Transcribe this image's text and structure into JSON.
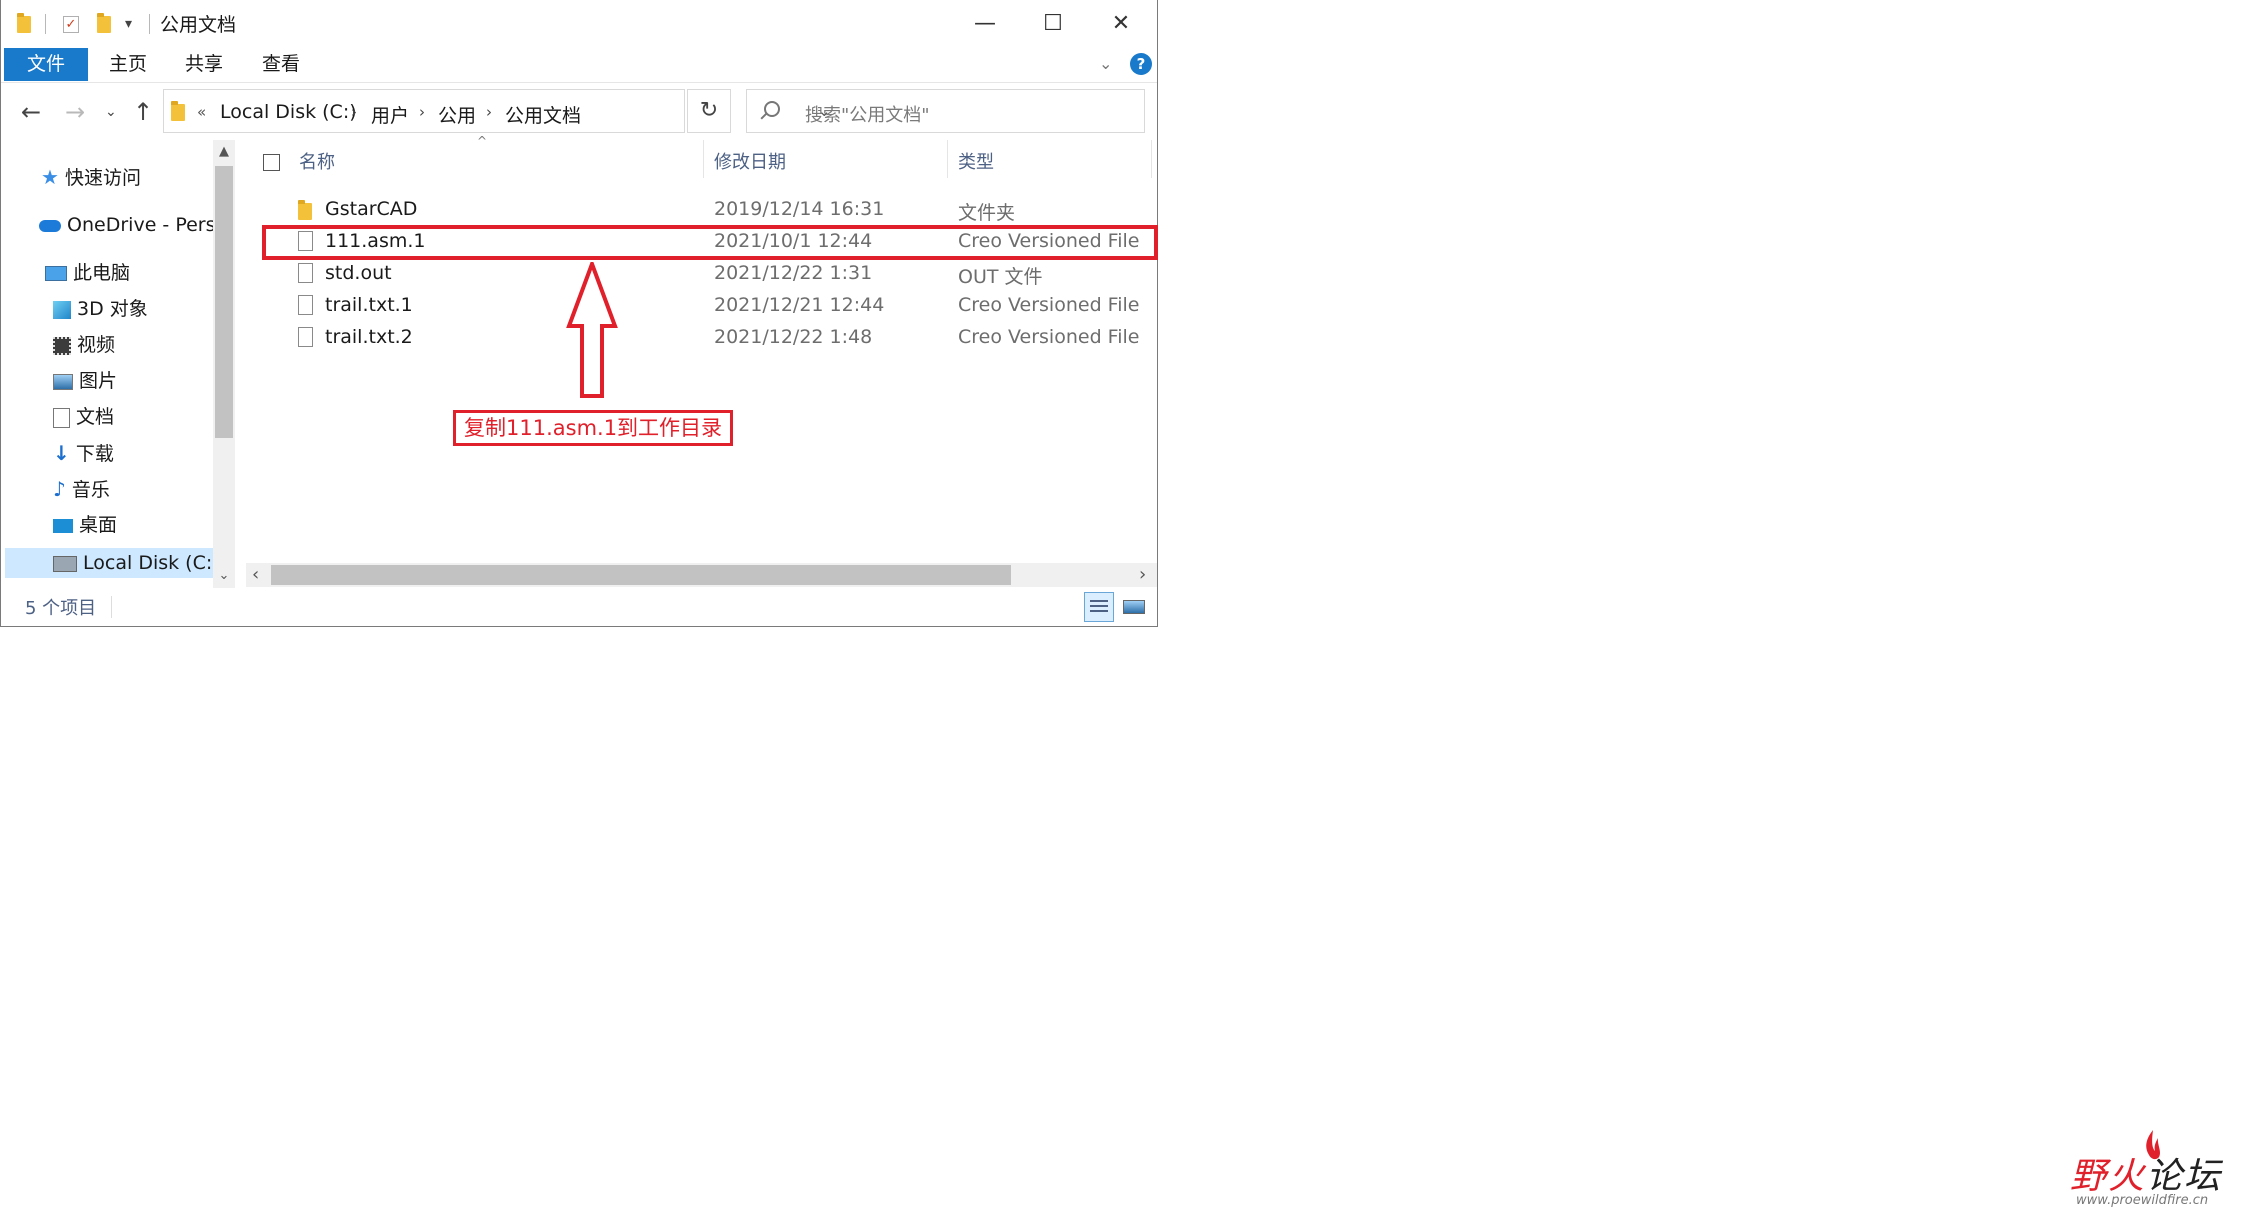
{
  "window": {
    "title": "公用文档",
    "controls": {
      "minimize": "—",
      "maximize": "☐",
      "close": "✕"
    }
  },
  "ribbon": {
    "tabs": [
      "文件",
      "主页",
      "共享",
      "查看"
    ],
    "help": "?"
  },
  "address": {
    "prefix": "«",
    "crumbs": [
      "Local Disk (C:)",
      "用户",
      "公用",
      "公用文档"
    ],
    "search_placeholder": "搜索\"公用文档\""
  },
  "nav_pane": {
    "items": [
      {
        "label": "快速访问",
        "icon": "star-icon"
      },
      {
        "label": "OneDrive - Perso",
        "icon": "cloud-icon"
      },
      {
        "label": "此电脑",
        "icon": "computer-icon"
      },
      {
        "label": "3D 对象",
        "icon": "cube-icon"
      },
      {
        "label": "视频",
        "icon": "film-icon"
      },
      {
        "label": "图片",
        "icon": "picture-icon"
      },
      {
        "label": "文档",
        "icon": "document-icon"
      },
      {
        "label": "下载",
        "icon": "download-icon"
      },
      {
        "label": "音乐",
        "icon": "music-icon"
      },
      {
        "label": "桌面",
        "icon": "desktop-icon"
      },
      {
        "label": "Local Disk (C:)",
        "icon": "drive-icon",
        "selected": true
      }
    ]
  },
  "file_list": {
    "columns": {
      "name": "名称",
      "date": "修改日期",
      "type": "类型"
    },
    "rows": [
      {
        "name": "GstarCAD",
        "date": "2019/12/14 16:31",
        "type": "文件夹",
        "kind": "folder"
      },
      {
        "name": "111.asm.1",
        "date": "2021/10/1 12:44",
        "type": "Creo Versioned File",
        "kind": "file"
      },
      {
        "name": "std.out",
        "date": "2021/12/22 1:31",
        "type": "OUT 文件",
        "kind": "file"
      },
      {
        "name": "trail.txt.1",
        "date": "2021/12/21 12:44",
        "type": "Creo Versioned File",
        "kind": "file"
      },
      {
        "name": "trail.txt.2",
        "date": "2021/12/22 1:48",
        "type": "Creo Versioned File",
        "kind": "file"
      }
    ]
  },
  "status": {
    "item_count": "5 个项目"
  },
  "annotation": {
    "label": "复制111.asm.1到工作目录",
    "color": "#e0202a"
  },
  "watermark": {
    "main_a": "野",
    "main_b": "火",
    "main_c": "论坛",
    "url": "www.proewildfire.cn"
  }
}
